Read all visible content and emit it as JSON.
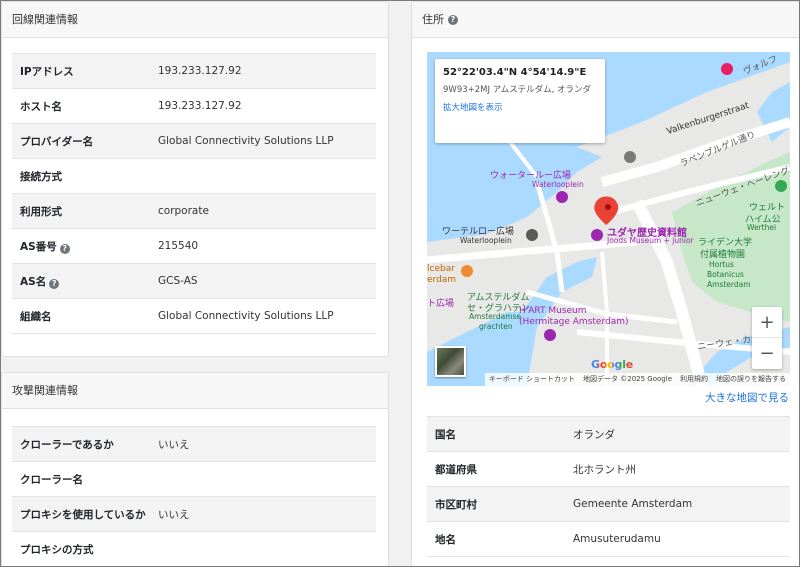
{
  "line_info": {
    "title": "回線関連情報",
    "rows": [
      {
        "key": "IPアドレス",
        "value": "193.233.127.92"
      },
      {
        "key": "ホスト名",
        "value": "193.233.127.92"
      },
      {
        "key": "プロバイダー名",
        "value": "Global Connectivity Solutions LLP"
      },
      {
        "key": "接続方式",
        "value": ""
      },
      {
        "key": "利用形式",
        "value": "corporate"
      },
      {
        "key": "AS番号",
        "value": "215540"
      },
      {
        "key": "AS名",
        "value": "GCS-AS"
      },
      {
        "key": "組織名",
        "value": "Global Connectivity Solutions LLP"
      }
    ]
  },
  "attack_info": {
    "title": "攻撃関連情報",
    "rows": [
      {
        "key": "クローラーであるか",
        "value": "いいえ"
      },
      {
        "key": "クローラー名",
        "value": ""
      },
      {
        "key": "プロキシを使用しているか",
        "value": "いいえ"
      },
      {
        "key": "プロキシの方式",
        "value": ""
      }
    ]
  },
  "address": {
    "title": "住所",
    "help_icon": "?",
    "map": {
      "coordinates": "52°22'03.4\"N 4°54'14.9\"E",
      "plus_code": "9W93+2MJ アムステルダム, オランダ",
      "enlarge_link": "拡大地図を表示",
      "labels": {
        "street1": "Valkenburgerstraat",
        "street2": "ラペンブルゲル通り",
        "street3": "ニューウェ・ヘーレングラハト",
        "street4": "ヴォルフ",
        "street5": "ニーウェ・カイゼル",
        "waterloo_ja1": "ウォータールー広場",
        "waterloo_en1": "Waterlooplein",
        "waterloo_ja2": "ワーテルロー広場",
        "waterloo_en2": "Waterlooplein",
        "museum_ja": "ユダヤ歴史資料館",
        "museum_en": "Joods Museum + junior",
        "univ1": "ライデン大学",
        "univ2": "付属植物園",
        "hortus1": "Hortus",
        "hortus2": "Botanicus",
        "hortus3": "Amsterdam",
        "park1": "ウェルト",
        "park2": "ハイム公",
        "park3": "Werthei",
        "cebar1": "lcebar",
        "cebar2": "erdam",
        "plaza": "ト広場",
        "gracht1": "アムステルダム",
        "gracht2": "セ・グラハテン",
        "gracht3": "Amsterdamse",
        "gracht4": "grachten",
        "hart1": "H'ART Museum",
        "hart2": "(Hermitage Amsterdam)"
      },
      "google": "Google",
      "attribution": {
        "shortcuts": "キーボード ショートカット",
        "data": "地図データ ©2025 Google",
        "terms": "利用規約",
        "report": "地図の誤りを報告する"
      },
      "zoom_in": "+",
      "zoom_out": "−"
    },
    "bigmap_link": "大きな地図で見る",
    "rows": [
      {
        "key": "国名",
        "value": "オランダ"
      },
      {
        "key": "都道府県",
        "value": "北ホラント州"
      },
      {
        "key": "市区町村",
        "value": "Gemeente Amsterdam"
      },
      {
        "key": "地名",
        "value": "Amusuterudamu"
      }
    ]
  },
  "colors": {
    "water": "#aadaff",
    "park": "#c8e6c9",
    "road": "#ffffff",
    "pin": "#ea4335",
    "museum_purple": "#9c27b0",
    "link_blue": "#1a73e8"
  }
}
